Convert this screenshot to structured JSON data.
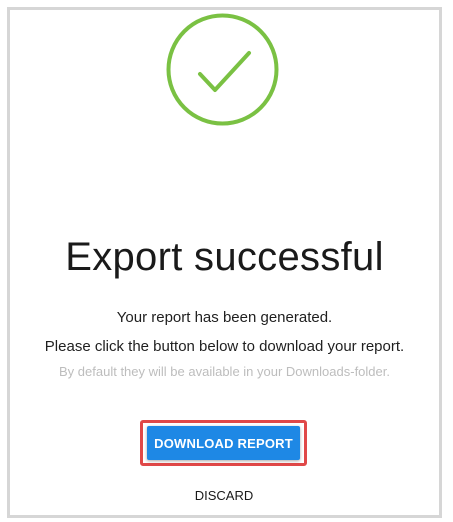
{
  "dialog": {
    "icon": "checkmark-circle-icon",
    "icon_color": "#7ac143",
    "title": "Export successful",
    "message_line_1": "Your report has been generated.",
    "message_line_2": "Please click the button below to download your report.",
    "message_line_3": "By default they will be available in your Downloads-folder."
  },
  "actions": {
    "download_label": "DOWNLOAD REPORT",
    "download_color": "#1e88e5",
    "discard_label": "DISCARD",
    "highlight_color": "#e04848"
  }
}
